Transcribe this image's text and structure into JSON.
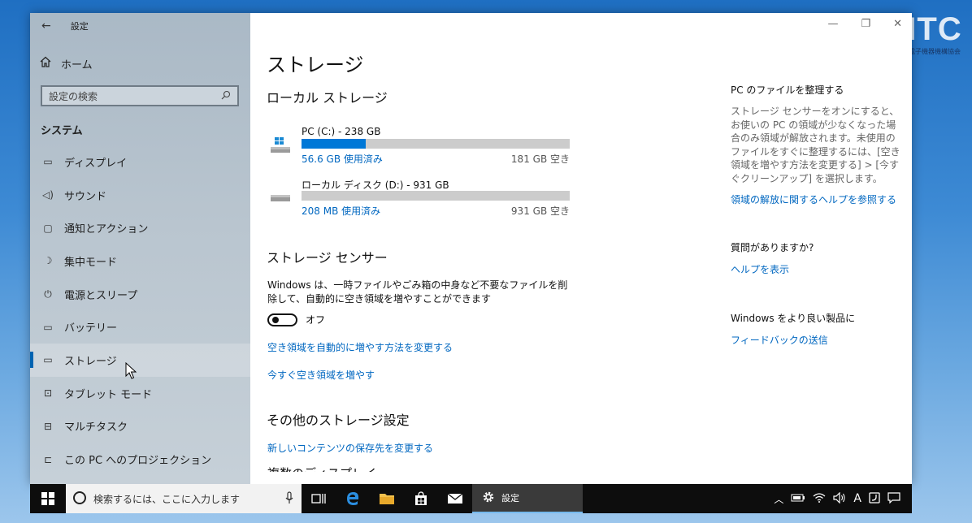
{
  "background": {
    "logo_text": "ITC",
    "logo_subtext": "電子機器機構協会"
  },
  "window": {
    "title": "設定",
    "controls": {
      "minimize": "—",
      "restore": "❐",
      "close": "✕"
    }
  },
  "sidebar": {
    "home_label": "ホーム",
    "search_placeholder": "設定の検索",
    "section_title": "システム",
    "items": [
      {
        "label": "ディスプレイ",
        "icon": "display-icon",
        "glyph": "▭"
      },
      {
        "label": "サウンド",
        "icon": "sound-icon",
        "glyph": "◁)"
      },
      {
        "label": "通知とアクション",
        "icon": "notification-icon",
        "glyph": "▢"
      },
      {
        "label": "集中モード",
        "icon": "moon-icon",
        "glyph": "☽"
      },
      {
        "label": "電源とスリープ",
        "icon": "power-icon",
        "glyph": "⏻"
      },
      {
        "label": "バッテリー",
        "icon": "battery-icon",
        "glyph": "▭"
      },
      {
        "label": "ストレージ",
        "icon": "storage-icon",
        "glyph": "▭",
        "active": true
      },
      {
        "label": "タブレット モード",
        "icon": "tablet-icon",
        "glyph": "⊡"
      },
      {
        "label": "マルチタスク",
        "icon": "multitask-icon",
        "glyph": "⊟"
      },
      {
        "label": "この PC へのプロジェクション",
        "icon": "projection-icon",
        "glyph": "⊏"
      }
    ]
  },
  "main": {
    "title": "ストレージ",
    "local_storage_heading": "ローカル ストレージ",
    "drives": [
      {
        "name": "PC (C:) - 238 GB",
        "used": "56.6 GB 使用済み",
        "free": "181 GB 空き",
        "used_fraction": 0.238,
        "icon": "windows-drive-icon"
      },
      {
        "name": "ローカル ディスク (D:) - 931 GB",
        "used": "208 MB 使用済み",
        "free": "931 GB 空き",
        "used_fraction": 0.0002,
        "icon": "disk-drive-icon"
      }
    ],
    "sense_heading": "ストレージ センサー",
    "sense_description": "Windows は、一時ファイルやごみ箱の中身など不要なファイルを削除して、自動的に空き領域を増やすことができます",
    "toggle_label": "オフ",
    "toggle_on": false,
    "link_change": "空き領域を自動的に増やす方法を変更する",
    "link_free_now": "今すぐ空き領域を増やす",
    "other_heading": "その他のストレージ設定",
    "link_save_location": "新しいコンテンツの保存先を変更する",
    "cutoff_text": "複数のディスプレイ"
  },
  "right_panel": {
    "organize_heading": "PC のファイルを整理する",
    "organize_text": "ストレージ センサーをオンにすると、お使いの PC の領域が少なくなった場合のみ領域が解放されます。未使用のファイルをすぐに整理するには、[空き領域を増やす方法を変更する] > [今すぐクリーンアップ] を選択します。",
    "organize_link": "領域の解放に関するヘルプを参照する",
    "question_heading": "質問がありますか?",
    "help_link": "ヘルプを表示",
    "better_heading": "Windows をより良い製品に",
    "feedback_link": "フィードバックの送信"
  },
  "taskbar": {
    "search_placeholder": "検索するには、ここに入力します",
    "active_app_label": "設定",
    "tray_ime": "A"
  },
  "colors": {
    "accent": "#0078d7",
    "link": "#0067c0",
    "taskbar": "#0d0d0d"
  }
}
